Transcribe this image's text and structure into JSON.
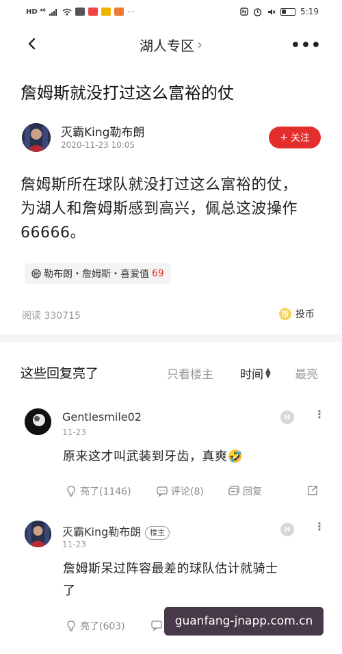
{
  "status_bar": {
    "left_text": "HD ⁴⁶",
    "time": "5:19"
  },
  "nav": {
    "title": "湖人专区",
    "title_chevron": "›",
    "more": "•••"
  },
  "post": {
    "title": "詹姆斯就没打过这么富裕的仗",
    "author": "灭霸King勒布朗",
    "time": "2020-11-23 10:05",
    "follow_label": "关注",
    "follow_plus": "+",
    "body_line1": "詹姆斯所在球队就没打过这么富裕的仗，",
    "body_line2": "为湖人和詹姆斯感到高兴，佩总这波操作",
    "body_line3": "66666。",
    "tag_text": "勒布朗・詹姆斯・喜爱值",
    "tag_score": "69",
    "reads": "阅读 330715",
    "coin_label": "投币",
    "coin_icon_text": "币"
  },
  "replies": {
    "title": "这些回复亮了",
    "filter_op": "只看楼主",
    "filter_time": "时间",
    "filter_hot": "最亮"
  },
  "comments": [
    {
      "name": "Gentlesmile02",
      "time": "11-23",
      "text": "原来这才叫武装到牙齿，真爽🤣",
      "like": "亮了(1146)",
      "reply": "评论(8)",
      "quote": "回复",
      "badge": "H"
    },
    {
      "name": "灭霸King勒布朗",
      "op_badge": "楼主",
      "time": "11-23",
      "text_line1": "詹姆斯呆过阵容最差的球队估计就骑士",
      "text_line2": "了",
      "like": "亮了(603)",
      "badge": "H"
    }
  ],
  "watermark": "guanfang-jnapp.com.cn",
  "colors": {
    "accent": "#e42d2d",
    "muted": "#999999",
    "divider": "#f5f5f5"
  },
  "icons": [
    "back-arrow-icon",
    "more-icon",
    "plus-icon",
    "basketball-icon",
    "coin-icon",
    "sort-arrows-icon",
    "like-icon",
    "comment-icon",
    "reply-icon",
    "share-icon",
    "kebab-icon"
  ]
}
